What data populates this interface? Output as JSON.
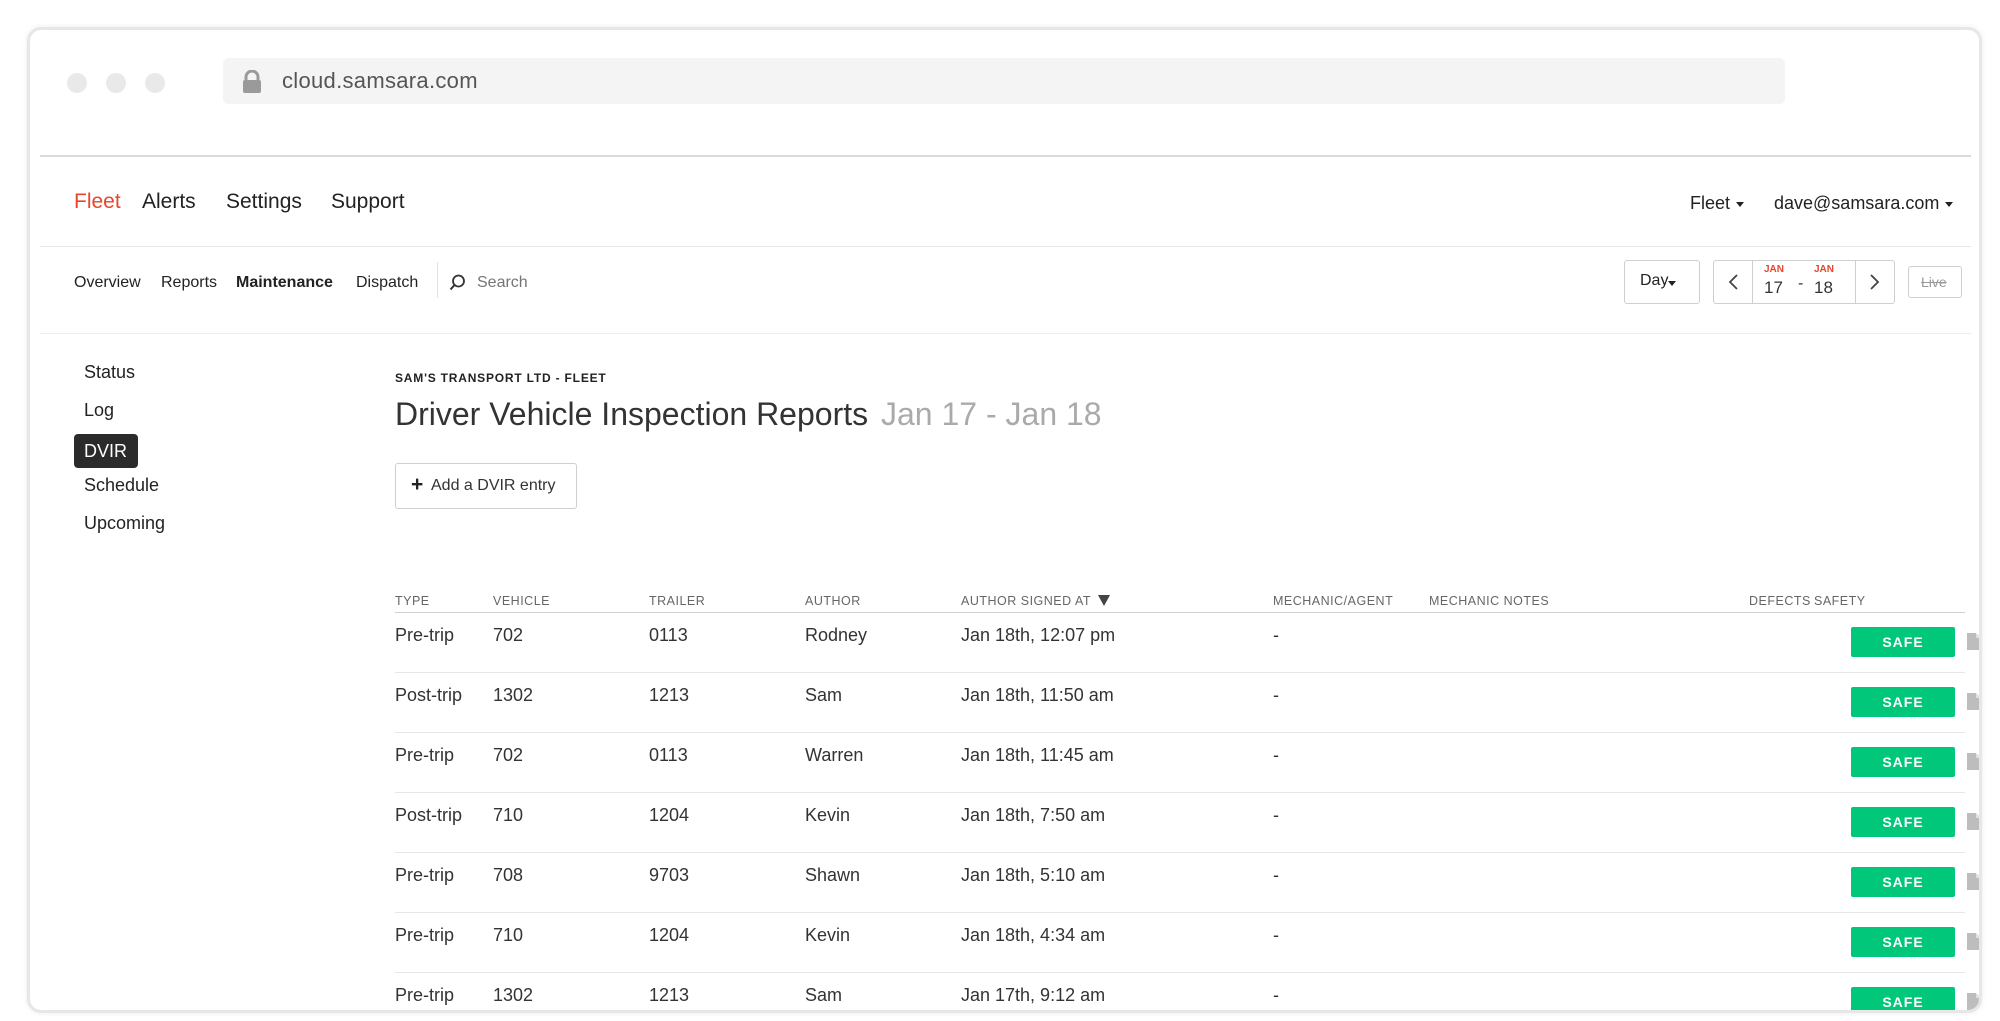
{
  "browser": {
    "url": "cloud.samsara.com"
  },
  "main_nav": {
    "fleet": "Fleet",
    "alerts": "Alerts",
    "settings": "Settings",
    "support": "Support"
  },
  "account": {
    "fleet_menu": "Fleet",
    "email": "dave@samsara.com"
  },
  "sub_nav": {
    "overview": "Overview",
    "reports": "Reports",
    "maintenance": "Maintenance",
    "dispatch": "Dispatch",
    "search_placeholder": "Search"
  },
  "controls": {
    "day": "Day",
    "date_from": {
      "month": "JAN",
      "day": "17"
    },
    "date_sep": "-",
    "date_to": {
      "month": "JAN",
      "day": "18"
    },
    "live": "Live"
  },
  "sidebar": {
    "items": [
      "Status",
      "Log",
      "DVIR",
      "Schedule",
      "Upcoming"
    ]
  },
  "page": {
    "org": "SAM'S TRANSPORT LTD - FLEET",
    "title": "Driver Vehicle Inspection Reports",
    "range": "Jan 17 - Jan 18",
    "add_button": "Add a DVIR entry"
  },
  "table": {
    "headers": {
      "type": "TYPE",
      "vehicle": "VEHICLE",
      "trailer": "TRAILER",
      "author": "AUTHOR",
      "signed": "AUTHOR SIGNED AT",
      "mechanic": "MECHANIC/AGENT",
      "notes": "MECHANIC NOTES",
      "defects": "DEFECTS",
      "safety": "SAFETY"
    },
    "rows": [
      {
        "type": "Pre-trip",
        "vehicle": "702",
        "trailer": "0113",
        "author": "Rodney",
        "signed": "Jan 18th, 12:07 pm",
        "mechanic": "-",
        "safety": "SAFE"
      },
      {
        "type": "Post-trip",
        "vehicle": "1302",
        "trailer": "1213",
        "author": "Sam",
        "signed": "Jan 18th, 11:50 am",
        "mechanic": "-",
        "safety": "SAFE"
      },
      {
        "type": "Pre-trip",
        "vehicle": "702",
        "trailer": "0113",
        "author": "Warren",
        "signed": "Jan 18th, 11:45 am",
        "mechanic": "-",
        "safety": "SAFE"
      },
      {
        "type": "Post-trip",
        "vehicle": "710",
        "trailer": "1204",
        "author": "Kevin",
        "signed": "Jan 18th, 7:50 am",
        "mechanic": "-",
        "safety": "SAFE"
      },
      {
        "type": "Pre-trip",
        "vehicle": "708",
        "trailer": "9703",
        "author": "Shawn",
        "signed": "Jan 18th, 5:10 am",
        "mechanic": "-",
        "safety": "SAFE"
      },
      {
        "type": "Pre-trip",
        "vehicle": "710",
        "trailer": "1204",
        "author": "Kevin",
        "signed": "Jan 18th, 4:34 am",
        "mechanic": "-",
        "safety": "SAFE"
      },
      {
        "type": "Pre-trip",
        "vehicle": "1302",
        "trailer": "1213",
        "author": "Sam",
        "signed": "Jan 17th, 9:12 am",
        "mechanic": "-",
        "safety": "SAFE"
      }
    ]
  },
  "colors": {
    "accent": "#e8462c",
    "safe": "#00c77a",
    "active_pill": "#2b2b2b"
  }
}
